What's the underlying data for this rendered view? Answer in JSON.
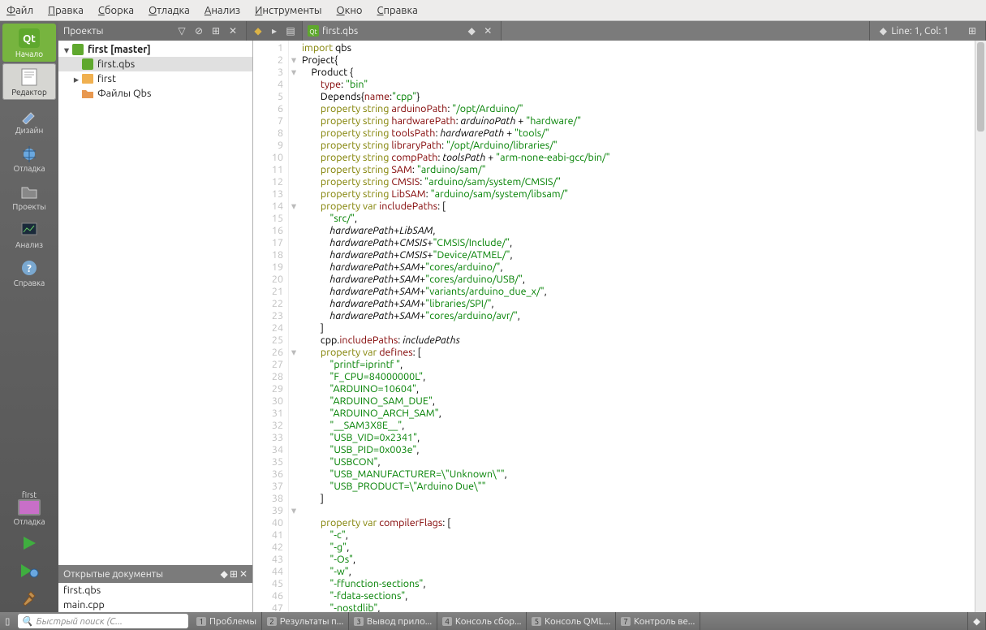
{
  "menu": [
    "Файл",
    "Правка",
    "Сборка",
    "Отладка",
    "Анализ",
    "Инструменты",
    "Окно",
    "Справка"
  ],
  "sidebar": [
    {
      "id": "start",
      "label": "Начало"
    },
    {
      "id": "editor",
      "label": "Редактор"
    },
    {
      "id": "design",
      "label": "Дизайн"
    },
    {
      "id": "debug",
      "label": "Отладка"
    },
    {
      "id": "projects",
      "label": "Проекты"
    },
    {
      "id": "analyze",
      "label": "Анализ"
    },
    {
      "id": "help",
      "label": "Справка"
    }
  ],
  "kit": {
    "name": "first",
    "mode": "Отладка"
  },
  "toolbar": {
    "projects_label": "Проекты",
    "file_tab": "first.qbs",
    "cursor": "Line: 1, Col: 1"
  },
  "tree": {
    "root": "first [master]",
    "file1": "first.qbs",
    "folder": "first",
    "folder2": "Файлы Qbs"
  },
  "opendocs": {
    "header": "Открытые документы",
    "items": [
      "first.qbs",
      "main.cpp"
    ]
  },
  "bottombar": {
    "search_placeholder": "Быстрый поиск (C...",
    "panes": [
      {
        "n": "1",
        "t": "Проблемы"
      },
      {
        "n": "2",
        "t": "Результаты п..."
      },
      {
        "n": "3",
        "t": "Вывод прило..."
      },
      {
        "n": "4",
        "t": "Консоль сбор..."
      },
      {
        "n": "5",
        "t": "Консоль QML..."
      },
      {
        "n": "7",
        "t": "Контроль ве..."
      }
    ]
  },
  "code_lines": [
    {
      "n": 1,
      "f": "",
      "t": [
        [
          "kw",
          "import"
        ],
        [
          "",
          " qbs"
        ]
      ]
    },
    {
      "n": 2,
      "f": "▾",
      "t": [
        [
          "",
          "Project{"
        ]
      ]
    },
    {
      "n": 3,
      "f": "▾",
      "t": [
        [
          "",
          "    Product {"
        ]
      ]
    },
    {
      "n": 4,
      "f": "",
      "t": [
        [
          "",
          "        "
        ],
        [
          "nm",
          "type"
        ],
        [
          "",
          ": "
        ],
        [
          "str",
          "\"bin\""
        ]
      ]
    },
    {
      "n": 5,
      "f": "",
      "t": [
        [
          "",
          "        Depends{"
        ],
        [
          "nm",
          "name"
        ],
        [
          "",
          ":"
        ],
        [
          "str",
          "\"cpp\""
        ],
        [
          "",
          "}"
        ]
      ]
    },
    {
      "n": 6,
      "f": "",
      "t": [
        [
          "",
          "        "
        ],
        [
          "kw",
          "property"
        ],
        [
          "",
          " "
        ],
        [
          "ty",
          "string"
        ],
        [
          "",
          " "
        ],
        [
          "nm",
          "arduinoPath"
        ],
        [
          "",
          ": "
        ],
        [
          "str",
          "\"/opt/Arduino/\""
        ]
      ]
    },
    {
      "n": 7,
      "f": "",
      "t": [
        [
          "",
          "        "
        ],
        [
          "kw",
          "property"
        ],
        [
          "",
          " "
        ],
        [
          "ty",
          "string"
        ],
        [
          "",
          " "
        ],
        [
          "nm",
          "hardwarePath"
        ],
        [
          "",
          ": "
        ],
        [
          "it",
          "arduinoPath"
        ],
        [
          "",
          " + "
        ],
        [
          "str",
          "\"hardware/\""
        ]
      ]
    },
    {
      "n": 8,
      "f": "",
      "t": [
        [
          "",
          "        "
        ],
        [
          "kw",
          "property"
        ],
        [
          "",
          " "
        ],
        [
          "ty",
          "string"
        ],
        [
          "",
          " "
        ],
        [
          "nm",
          "toolsPath"
        ],
        [
          "",
          ": "
        ],
        [
          "it",
          "hardwarePath"
        ],
        [
          "",
          " + "
        ],
        [
          "str",
          "\"tools/\""
        ]
      ]
    },
    {
      "n": 9,
      "f": "",
      "t": [
        [
          "",
          "        "
        ],
        [
          "kw",
          "property"
        ],
        [
          "",
          " "
        ],
        [
          "ty",
          "string"
        ],
        [
          "",
          " "
        ],
        [
          "nm",
          "libraryPath"
        ],
        [
          "",
          ": "
        ],
        [
          "str",
          "\"/opt/Arduino/libraries/\""
        ]
      ]
    },
    {
      "n": 10,
      "f": "",
      "t": [
        [
          "",
          "        "
        ],
        [
          "kw",
          "property"
        ],
        [
          "",
          " "
        ],
        [
          "ty",
          "string"
        ],
        [
          "",
          " "
        ],
        [
          "nm",
          "compPath"
        ],
        [
          "",
          ": "
        ],
        [
          "it",
          "toolsPath"
        ],
        [
          "",
          " + "
        ],
        [
          "str",
          "\"arm-none-eabi-gcc/bin/\""
        ]
      ]
    },
    {
      "n": 11,
      "f": "",
      "t": [
        [
          "",
          "        "
        ],
        [
          "kw",
          "property"
        ],
        [
          "",
          " "
        ],
        [
          "ty",
          "string"
        ],
        [
          "",
          " "
        ],
        [
          "nm",
          "SAM"
        ],
        [
          "",
          ": "
        ],
        [
          "str",
          "\"arduino/sam/\""
        ]
      ]
    },
    {
      "n": 12,
      "f": "",
      "t": [
        [
          "",
          "        "
        ],
        [
          "kw",
          "property"
        ],
        [
          "",
          " "
        ],
        [
          "ty",
          "string"
        ],
        [
          "",
          " "
        ],
        [
          "nm",
          "CMSIS"
        ],
        [
          "",
          ": "
        ],
        [
          "str",
          "\"arduino/sam/system/CMSIS/\""
        ]
      ]
    },
    {
      "n": 13,
      "f": "",
      "t": [
        [
          "",
          "        "
        ],
        [
          "kw",
          "property"
        ],
        [
          "",
          " "
        ],
        [
          "ty",
          "string"
        ],
        [
          "",
          " "
        ],
        [
          "nm",
          "LibSAM"
        ],
        [
          "",
          ": "
        ],
        [
          "str",
          "\"arduino/sam/system/libsam/\""
        ]
      ]
    },
    {
      "n": 14,
      "f": "▾",
      "t": [
        [
          "",
          "        "
        ],
        [
          "kw",
          "property"
        ],
        [
          "",
          " "
        ],
        [
          "ty",
          "var"
        ],
        [
          "",
          " "
        ],
        [
          "nm",
          "includePaths"
        ],
        [
          "",
          ": ["
        ]
      ]
    },
    {
      "n": 15,
      "f": "",
      "t": [
        [
          "",
          "            "
        ],
        [
          "str",
          "\"src/\""
        ],
        [
          "",
          ","
        ]
      ]
    },
    {
      "n": 16,
      "f": "",
      "t": [
        [
          "",
          "            "
        ],
        [
          "it",
          "hardwarePath"
        ],
        [
          "",
          "+"
        ],
        [
          "it",
          "LibSAM"
        ],
        [
          "",
          ","
        ]
      ]
    },
    {
      "n": 17,
      "f": "",
      "t": [
        [
          "",
          "            "
        ],
        [
          "it",
          "hardwarePath"
        ],
        [
          "",
          "+"
        ],
        [
          "it",
          "CMSIS"
        ],
        [
          "",
          "+"
        ],
        [
          "str",
          "\"CMSIS/Include/\""
        ],
        [
          "",
          ","
        ]
      ]
    },
    {
      "n": 18,
      "f": "",
      "t": [
        [
          "",
          "            "
        ],
        [
          "it",
          "hardwarePath"
        ],
        [
          "",
          "+"
        ],
        [
          "it",
          "CMSIS"
        ],
        [
          "",
          "+"
        ],
        [
          "str",
          "\"Device/ATMEL/\""
        ],
        [
          "",
          ","
        ]
      ]
    },
    {
      "n": 19,
      "f": "",
      "t": [
        [
          "",
          "            "
        ],
        [
          "it",
          "hardwarePath"
        ],
        [
          "",
          "+"
        ],
        [
          "it",
          "SAM"
        ],
        [
          "",
          "+"
        ],
        [
          "str",
          "\"cores/arduino/\""
        ],
        [
          "",
          ","
        ]
      ]
    },
    {
      "n": 20,
      "f": "",
      "t": [
        [
          "",
          "            "
        ],
        [
          "it",
          "hardwarePath"
        ],
        [
          "",
          "+"
        ],
        [
          "it",
          "SAM"
        ],
        [
          "",
          "+"
        ],
        [
          "str",
          "\"cores/arduino/USB/\""
        ],
        [
          "",
          ","
        ]
      ]
    },
    {
      "n": 21,
      "f": "",
      "t": [
        [
          "",
          "            "
        ],
        [
          "it",
          "hardwarePath"
        ],
        [
          "",
          "+"
        ],
        [
          "it",
          "SAM"
        ],
        [
          "",
          "+"
        ],
        [
          "str",
          "\"variants/arduino_due_x/\""
        ],
        [
          "",
          ","
        ]
      ]
    },
    {
      "n": 22,
      "f": "",
      "t": [
        [
          "",
          "            "
        ],
        [
          "it",
          "hardwarePath"
        ],
        [
          "",
          "+"
        ],
        [
          "it",
          "SAM"
        ],
        [
          "",
          "+"
        ],
        [
          "str",
          "\"libraries/SPI/\""
        ],
        [
          "",
          ","
        ]
      ]
    },
    {
      "n": 23,
      "f": "",
      "t": [
        [
          "",
          "            "
        ],
        [
          "it",
          "hardwarePath"
        ],
        [
          "",
          "+"
        ],
        [
          "it",
          "SAM"
        ],
        [
          "",
          "+"
        ],
        [
          "str",
          "\"cores/arduino/avr/\""
        ],
        [
          "",
          ","
        ]
      ]
    },
    {
      "n": 24,
      "f": "",
      "t": [
        [
          "",
          "        ]"
        ]
      ]
    },
    {
      "n": 25,
      "f": "",
      "t": [
        [
          "",
          "        cpp."
        ],
        [
          "nm",
          "includePaths"
        ],
        [
          "",
          ": "
        ],
        [
          "it",
          "includePaths"
        ]
      ]
    },
    {
      "n": 26,
      "f": "▾",
      "t": [
        [
          "",
          "        "
        ],
        [
          "kw",
          "property"
        ],
        [
          "",
          " "
        ],
        [
          "ty",
          "var"
        ],
        [
          "",
          " "
        ],
        [
          "nm",
          "defines"
        ],
        [
          "",
          ": ["
        ]
      ]
    },
    {
      "n": 27,
      "f": "",
      "t": [
        [
          "",
          "            "
        ],
        [
          "str",
          "\"printf=iprintf \""
        ],
        [
          "",
          ","
        ]
      ]
    },
    {
      "n": 28,
      "f": "",
      "t": [
        [
          "",
          "            "
        ],
        [
          "str",
          "\"F_CPU=84000000L\""
        ],
        [
          "",
          ","
        ]
      ]
    },
    {
      "n": 29,
      "f": "",
      "t": [
        [
          "",
          "            "
        ],
        [
          "str",
          "\"ARDUINO=10604\""
        ],
        [
          "",
          ","
        ]
      ]
    },
    {
      "n": 30,
      "f": "",
      "t": [
        [
          "",
          "            "
        ],
        [
          "str",
          "\"ARDUINO_SAM_DUE\""
        ],
        [
          "",
          ","
        ]
      ]
    },
    {
      "n": 31,
      "f": "",
      "t": [
        [
          "",
          "            "
        ],
        [
          "str",
          "\"ARDUINO_ARCH_SAM\""
        ],
        [
          "",
          ","
        ]
      ]
    },
    {
      "n": 32,
      "f": "",
      "t": [
        [
          "",
          "            "
        ],
        [
          "str",
          "\"__SAM3X8E__\""
        ],
        [
          "",
          ","
        ]
      ]
    },
    {
      "n": 33,
      "f": "",
      "t": [
        [
          "",
          "            "
        ],
        [
          "str",
          "\"USB_VID=0x2341\""
        ],
        [
          "",
          ","
        ]
      ]
    },
    {
      "n": 34,
      "f": "",
      "t": [
        [
          "",
          "            "
        ],
        [
          "str",
          "\"USB_PID=0x003e\""
        ],
        [
          "",
          ","
        ]
      ]
    },
    {
      "n": 35,
      "f": "",
      "t": [
        [
          "",
          "            "
        ],
        [
          "str",
          "\"USBCON\""
        ],
        [
          "",
          ","
        ]
      ]
    },
    {
      "n": 36,
      "f": "",
      "t": [
        [
          "",
          "            "
        ],
        [
          "str",
          "\"USB_MANUFACTURER=\\\"Unknown\\\"\""
        ],
        [
          "",
          ","
        ]
      ]
    },
    {
      "n": 37,
      "f": "",
      "t": [
        [
          "",
          "            "
        ],
        [
          "str",
          "\"USB_PRODUCT=\\\"Arduino Due\\\"\""
        ]
      ]
    },
    {
      "n": 38,
      "f": "",
      "t": [
        [
          "",
          "        ]"
        ]
      ]
    },
    {
      "n": 39,
      "f": "▾",
      "t": [
        [
          "",
          ""
        ]
      ]
    },
    {
      "n": 40,
      "f": "",
      "t": [
        [
          "",
          "        "
        ],
        [
          "kw",
          "property"
        ],
        [
          "",
          " "
        ],
        [
          "ty",
          "var"
        ],
        [
          "",
          " "
        ],
        [
          "nm",
          "compilerFlags"
        ],
        [
          "",
          ": ["
        ]
      ]
    },
    {
      "n": 41,
      "f": "",
      "t": [
        [
          "",
          "            "
        ],
        [
          "str",
          "\"-c\""
        ],
        [
          "",
          ","
        ]
      ]
    },
    {
      "n": 42,
      "f": "",
      "t": [
        [
          "",
          "            "
        ],
        [
          "str",
          "\"-g\""
        ],
        [
          "",
          ","
        ]
      ]
    },
    {
      "n": 43,
      "f": "",
      "t": [
        [
          "",
          "            "
        ],
        [
          "str",
          "\"-Os\""
        ],
        [
          "",
          ","
        ]
      ]
    },
    {
      "n": 44,
      "f": "",
      "t": [
        [
          "",
          "            "
        ],
        [
          "str",
          "\"-w\""
        ],
        [
          "",
          ","
        ]
      ]
    },
    {
      "n": 45,
      "f": "",
      "t": [
        [
          "",
          "            "
        ],
        [
          "str",
          "\"-ffunction-sections\""
        ],
        [
          "",
          ","
        ]
      ]
    },
    {
      "n": 46,
      "f": "",
      "t": [
        [
          "",
          "            "
        ],
        [
          "str",
          "\"-fdata-sections\""
        ],
        [
          "",
          ","
        ]
      ]
    },
    {
      "n": 47,
      "f": "",
      "t": [
        [
          "",
          "            "
        ],
        [
          "str",
          "\"-nostdlib\""
        ],
        [
          "",
          ","
        ]
      ]
    }
  ]
}
